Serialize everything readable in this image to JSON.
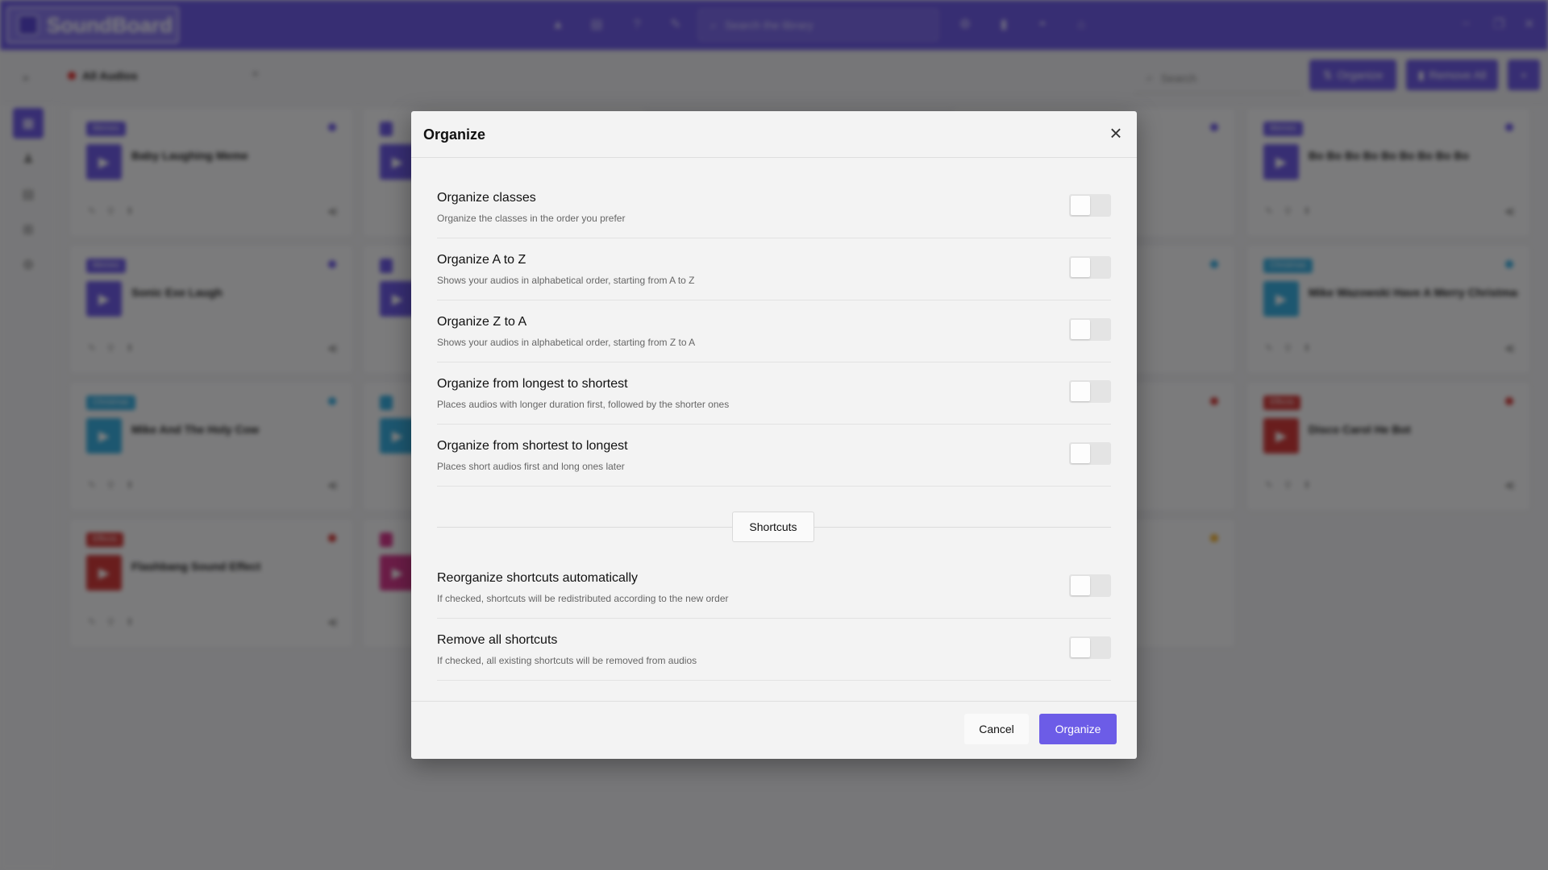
{
  "app": {
    "logo_text": "SoundBoard",
    "search_placeholder": "Search the library",
    "all_audios_label": "All Audios",
    "subsearch_placeholder": "Search",
    "organize_button": "Organize",
    "remove_all_button": "Remove All"
  },
  "cards": [
    {
      "tag": "Memes",
      "title": "Baby Laughing Meme",
      "color": "#6f5ce6"
    },
    {
      "tag": "Memes",
      "title": "Sonic Exe Laugh",
      "color": "#6f5ce6"
    },
    {
      "tag": "Christmas",
      "title": "Mike And The Holy Cow",
      "color": "#3aaee0"
    },
    {
      "tag": "Effects",
      "title": "Flashbang Sound Effect",
      "color": "#d23b3b"
    },
    {
      "tag": "Memes",
      "title": "Bo Bo Bo Bo Bo Bo Bo Bo Bo",
      "color": "#6f5ce6"
    },
    {
      "tag": "Christmas",
      "title": "Mike Wazowski Have A Merry Christmas",
      "color": "#3aaee0"
    },
    {
      "tag": "Effects",
      "title": "Disco Carol He Bot",
      "color": "#d23b3b"
    }
  ],
  "modal": {
    "title": "Organize",
    "options": [
      {
        "title": "Organize classes",
        "description": "Organize the classes in the order you prefer",
        "enabled": false
      },
      {
        "title": "Organize A to Z",
        "description": "Shows your audios in alphabetical order, starting from A to Z",
        "enabled": false
      },
      {
        "title": "Organize Z to A",
        "description": "Shows your audios in alphabetical order, starting from Z to A",
        "enabled": false
      },
      {
        "title": "Organize from longest to shortest",
        "description": "Places audios with longer duration first, followed by the shorter ones",
        "enabled": false
      },
      {
        "title": "Organize from shortest to longest",
        "description": "Places short audios first and long ones later",
        "enabled": false
      }
    ],
    "divider_label": "Shortcuts",
    "shortcut_options": [
      {
        "title": "Reorganize shortcuts automatically",
        "description": "If checked, shortcuts will be redistributed according to the new order",
        "enabled": false
      },
      {
        "title": "Remove all shortcuts",
        "description": "If checked, all existing shortcuts will be removed from audios",
        "enabled": false
      }
    ],
    "cancel_label": "Cancel",
    "organize_label": "Organize"
  },
  "colors": {
    "accent": "#6c5ce7",
    "topbar": "#6f5ce6",
    "toggle_off": "#e4e4e4"
  }
}
